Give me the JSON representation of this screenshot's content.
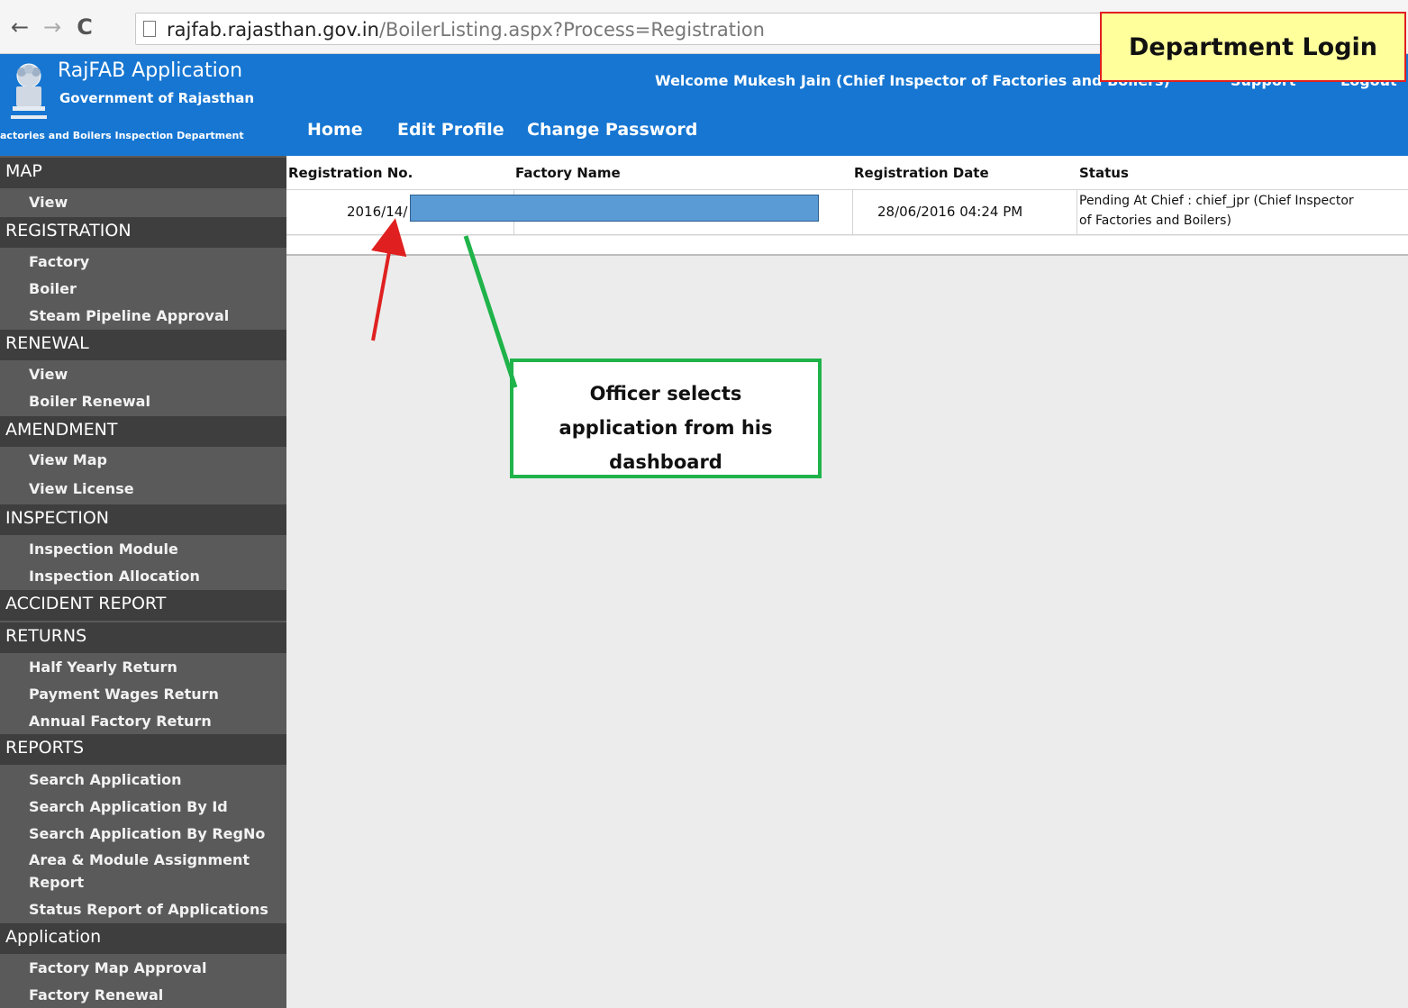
{
  "browser": {
    "url_host": "rajfab.rajasthan.gov.in",
    "url_path": "/BoilerListing.aspx?Process=Registration",
    "back_icon": "←",
    "forward_icon": "→",
    "reload_icon": "C"
  },
  "overlay_label": "Department Login",
  "header": {
    "app_title": "RajFAB Application",
    "government": "Government of Rajasthan",
    "department": "actories and Boilers Inspection Department",
    "welcome": "Welcome Mukesh Jain (Chief Inspector of Factories and Boilers)",
    "support": "Support",
    "logout": "Logout",
    "menu": [
      "Home",
      "Edit Profile",
      "Change Password"
    ]
  },
  "sidebar": {
    "sections": [
      {
        "title": "MAP",
        "items": [
          "View"
        ]
      },
      {
        "title": "REGISTRATION",
        "items": [
          "Factory",
          "Boiler",
          "Steam Pipeline Approval"
        ]
      },
      {
        "title": "RENEWAL",
        "items": [
          "View",
          "Boiler Renewal"
        ]
      },
      {
        "title": "AMENDMENT",
        "items": [
          "View Map",
          "View License"
        ]
      },
      {
        "title": "INSPECTION",
        "items": [
          "Inspection Module",
          "Inspection Allocation"
        ]
      },
      {
        "title": "ACCIDENT REPORT",
        "items": []
      },
      {
        "title": "RETURNS",
        "items": [
          "Half Yearly Return",
          "Payment Wages Return",
          "Annual Factory Return"
        ]
      },
      {
        "title": "REPORTS",
        "items": [
          "Search Application",
          "Search Application By Id",
          "Search Application By RegNo",
          "Area & Module Assignment",
          "Report",
          "Status Report of Applications"
        ]
      },
      {
        "title": "Application",
        "items": [
          "Factory Map Approval",
          "Factory Renewal"
        ]
      }
    ]
  },
  "table": {
    "columns": [
      "Registration No.",
      "Factory Name",
      "Registration Date",
      "Status"
    ],
    "rows": [
      {
        "registration_no": "2016/14/",
        "factory_name": "",
        "registration_date": "28/06/2016 04:24 PM",
        "status_line1": "Pending At Chief : chief_jpr (Chief Inspector",
        "status_line2": "of Factories and Boilers)"
      }
    ]
  },
  "callout": {
    "line1": "Officer selects",
    "line2": "application from his",
    "line3": "dashboard"
  },
  "colors": {
    "header_blue": "#1676d2",
    "sidebar": "#5a5a5a",
    "section": "#3e3e3e",
    "callout_border": "#1fb34a",
    "arrow_red": "#e02020",
    "overlay_fill": "#ffff9c"
  }
}
